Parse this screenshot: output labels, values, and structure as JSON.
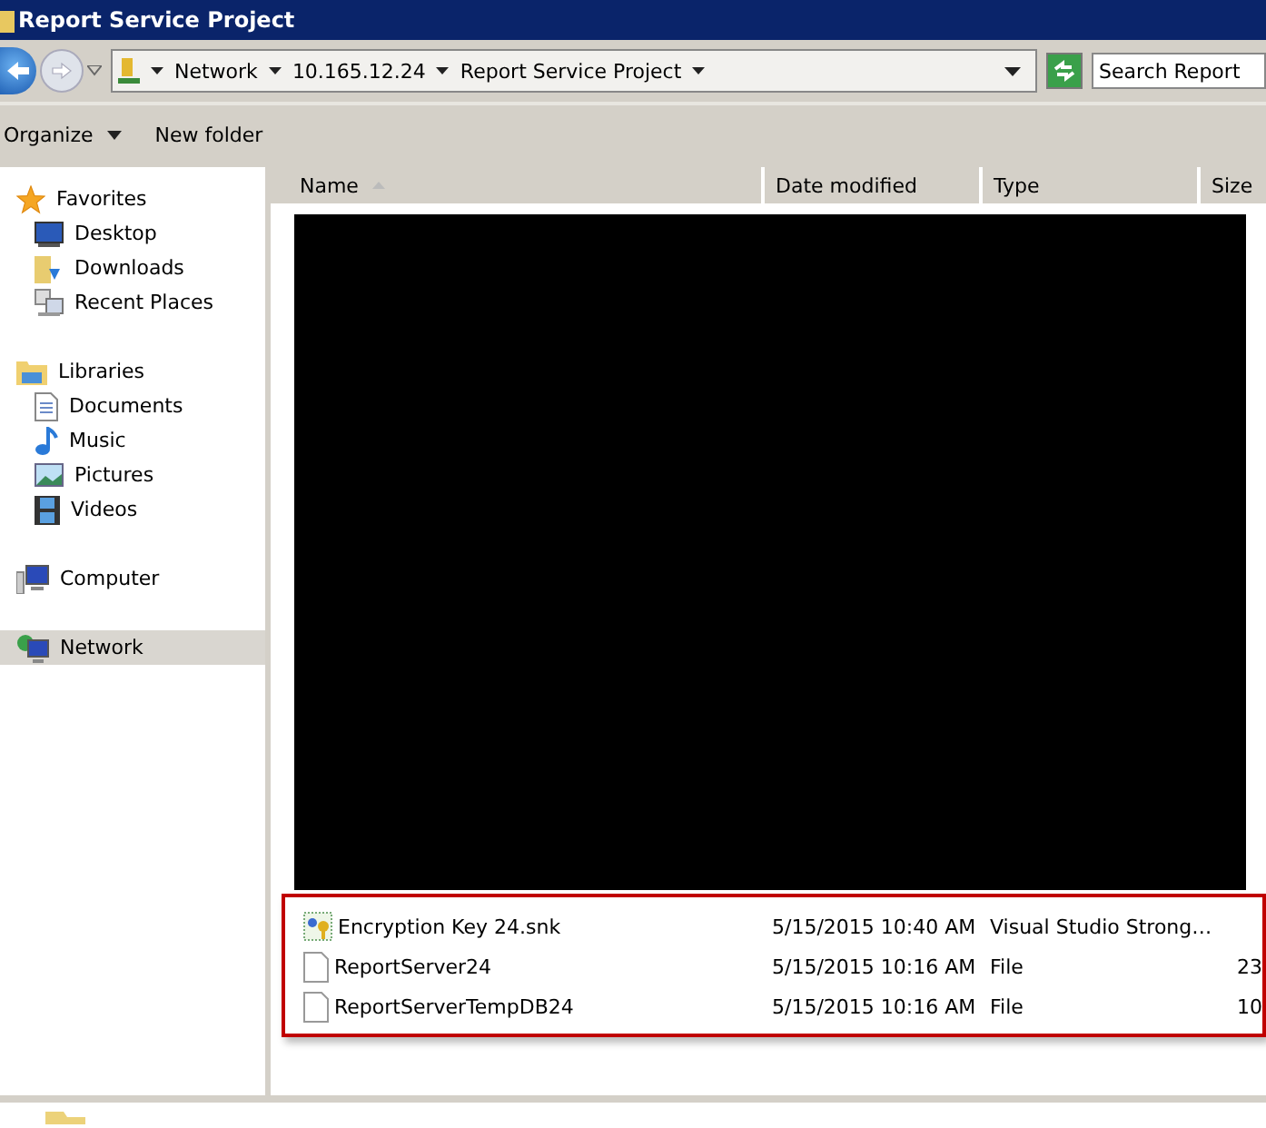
{
  "window": {
    "title": "Report Service Project"
  },
  "address_bar": {
    "crumbs": [
      "Network",
      "10.165.12.24",
      "Report Service Project"
    ]
  },
  "search": {
    "placeholder": "Search Report"
  },
  "toolbar": {
    "organize": "Organize",
    "new_folder": "New folder"
  },
  "sidebar": {
    "groups": [
      {
        "label": "Favorites",
        "kind": "star",
        "selected": false,
        "children": [
          {
            "label": "Desktop",
            "kind": "desktop",
            "selected": false
          },
          {
            "label": "Downloads",
            "kind": "downloads",
            "selected": false
          },
          {
            "label": "Recent Places",
            "kind": "recent",
            "selected": false
          }
        ]
      },
      {
        "label": "Libraries",
        "kind": "folder",
        "selected": false,
        "children": [
          {
            "label": "Documents",
            "kind": "document",
            "selected": false
          },
          {
            "label": "Music",
            "kind": "music",
            "selected": false
          },
          {
            "label": "Pictures",
            "kind": "pictures",
            "selected": false
          },
          {
            "label": "Videos",
            "kind": "videos",
            "selected": false
          }
        ]
      },
      {
        "label": "Computer",
        "kind": "computer",
        "selected": false
      },
      {
        "label": "Network",
        "kind": "network",
        "selected": true
      }
    ]
  },
  "table": {
    "columns": [
      "Name",
      "Date modified",
      "Type",
      "Size"
    ],
    "rows": [
      {
        "kind": "key",
        "name": "Encryption Key 24.snk",
        "date": "5/15/2015 10:40 AM",
        "type": "Visual Studio Strong…"
      },
      {
        "kind": "file",
        "name": "ReportServer24",
        "date": "5/15/2015 10:16 AM",
        "type": "File",
        "size": "23"
      },
      {
        "kind": "file",
        "name": "ReportServerTempDB24",
        "date": "5/15/2015 10:16 AM",
        "type": "File",
        "size": "10"
      }
    ]
  }
}
